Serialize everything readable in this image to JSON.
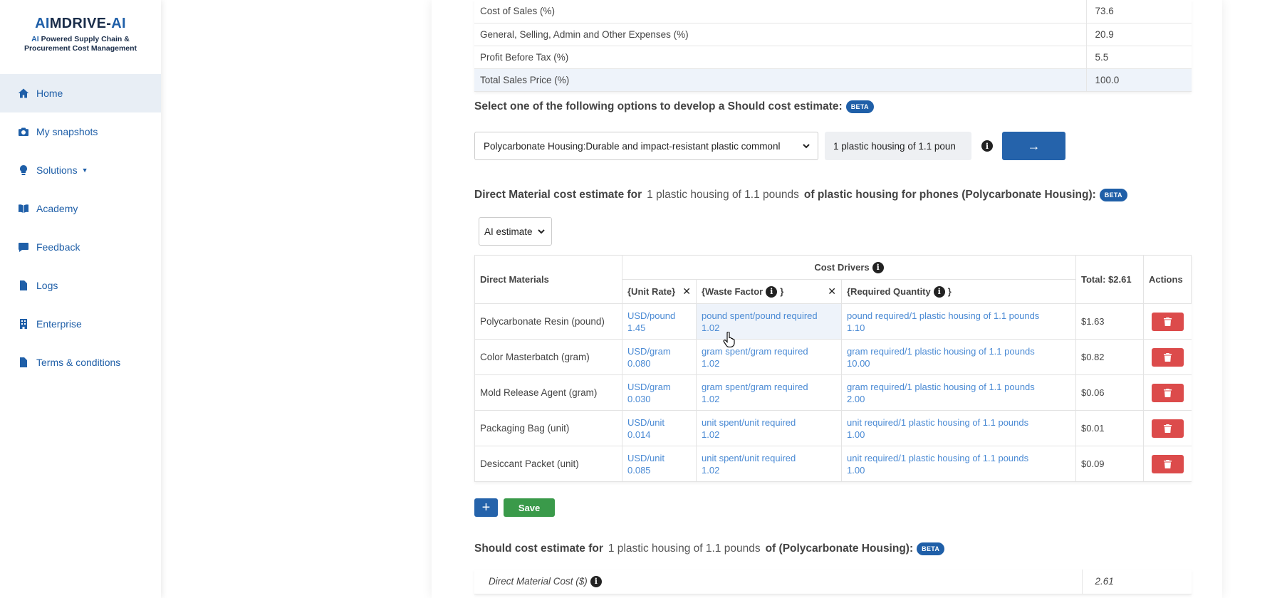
{
  "brand": {
    "title_ai": "AI",
    "title_rest": "MDRIVE-",
    "title_ai2": "AI",
    "subtitle_ai": "AI",
    "subtitle_line1": " Powered Supply Chain &",
    "subtitle_line2": "Procurement Cost Management"
  },
  "sidebar": {
    "items": [
      {
        "label": "Home",
        "icon": "home-icon"
      },
      {
        "label": "My snapshots",
        "icon": "camera-icon"
      },
      {
        "label": "Solutions",
        "icon": "lightbulb-icon"
      },
      {
        "label": "Academy",
        "icon": "book-icon"
      },
      {
        "label": "Feedback",
        "icon": "comment-icon"
      },
      {
        "label": "Logs",
        "icon": "file-icon"
      },
      {
        "label": "Enterprise",
        "icon": "building-icon"
      },
      {
        "label": "Terms & conditions",
        "icon": "document-icon"
      }
    ]
  },
  "summary": {
    "rows": [
      {
        "label": "Cost of Sales (%)",
        "value": "73.6"
      },
      {
        "label": "General, Selling, Admin and Other Expenses (%)",
        "value": "20.9"
      },
      {
        "label": "Profit Before Tax (%)",
        "value": "5.5"
      },
      {
        "label": "Total Sales Price (%)",
        "value": "100.0"
      }
    ]
  },
  "options": {
    "heading": "Select one of the following options to develop a Should cost estimate:",
    "beta": "BETA",
    "selected_option": "Polycarbonate Housing:Durable and impact-resistant plastic commonl",
    "quantity_value": "1 plastic housing of 1.1 poun",
    "go_icon": "→"
  },
  "dm_heading": {
    "prefix": "Direct Material cost estimate for",
    "quantity": "1 plastic housing of 1.1 pounds",
    "suffix": "of plastic housing for phones (Polycarbonate Housing):",
    "beta": "BETA"
  },
  "estimate_select": {
    "value": "AI estimate"
  },
  "dm_table": {
    "col_direct_materials": "Direct Materials",
    "col_cost_drivers": "Cost Drivers",
    "col_total": "Total: $2.61",
    "col_actions": "Actions",
    "sub_unit_rate": "{Unit Rate}",
    "sub_waste_factor": "{Waste Factor",
    "sub_waste_close": "}",
    "sub_required_qty": "{Required Quantity",
    "sub_required_close": "}",
    "close_icon": "✕",
    "rows": [
      {
        "name": "Polycarbonate Resin (pound)",
        "rate_unit": "USD/pound",
        "rate": "1.45",
        "waste_unit": "pound spent/pound required",
        "waste": "1.02",
        "qty_unit": "pound required/1 plastic housing of 1.1 pounds",
        "qty": "1.10",
        "total": "$1.63"
      },
      {
        "name": "Color Masterbatch (gram)",
        "rate_unit": "USD/gram",
        "rate": "0.080",
        "waste_unit": "gram spent/gram required",
        "waste": "1.02",
        "qty_unit": "gram required/1 plastic housing of 1.1 pounds",
        "qty": "10.00",
        "total": "$0.82"
      },
      {
        "name": "Mold Release Agent (gram)",
        "rate_unit": "USD/gram",
        "rate": "0.030",
        "waste_unit": "gram spent/gram required",
        "waste": "1.02",
        "qty_unit": "gram required/1 plastic housing of 1.1 pounds",
        "qty": "2.00",
        "total": "$0.06"
      },
      {
        "name": "Packaging Bag (unit)",
        "rate_unit": "USD/unit",
        "rate": "0.014",
        "waste_unit": "unit spent/unit required",
        "waste": "1.02",
        "qty_unit": "unit required/1 plastic housing of 1.1 pounds",
        "qty": "1.00",
        "total": "$0.01"
      },
      {
        "name": "Desiccant Packet (unit)",
        "rate_unit": "USD/unit",
        "rate": "0.085",
        "waste_unit": "unit spent/unit required",
        "waste": "1.02",
        "qty_unit": "unit required/1 plastic housing of 1.1 pounds",
        "qty": "1.00",
        "total": "$0.09"
      }
    ]
  },
  "buttons": {
    "add": "+",
    "save": "Save"
  },
  "sc_heading": {
    "prefix": "Should cost estimate for",
    "quantity": "1 plastic housing of 1.1 pounds",
    "suffix": "of (Polycarbonate Housing):",
    "beta": "BETA"
  },
  "sc_table": {
    "rows": [
      {
        "label": "Direct Material Cost ($)",
        "value": "2.61"
      }
    ]
  },
  "info_glyph": "i",
  "colors": {
    "accent": "#1f5fa8",
    "link": "#4a8ad4",
    "danger": "#dc4b4b",
    "success": "#3a9a4a"
  }
}
